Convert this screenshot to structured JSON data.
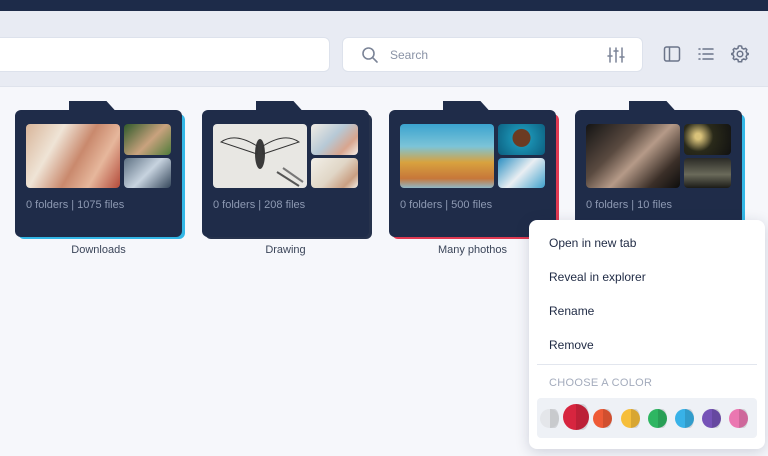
{
  "search": {
    "placeholder": "Search"
  },
  "toolbar": {
    "icons": [
      "search-icon",
      "filter-sliders-icon",
      "panel-icon",
      "list-view-icon",
      "gear-icon"
    ]
  },
  "folders": [
    {
      "name": "Downloads",
      "counts": "0 folders | 1075 files",
      "accent": "#33b7e6"
    },
    {
      "name": "Drawing",
      "counts": "0 folders | 208 files",
      "accent": ""
    },
    {
      "name": "Many phothos",
      "counts": "0 folders | 500 files",
      "accent": "#e03a52"
    },
    {
      "name": "",
      "counts": "0 folders | 10 files",
      "accent": "#33b7e6"
    }
  ],
  "context_menu": {
    "items": [
      "Open in new tab",
      "Reveal in explorer",
      "Rename",
      "Remove"
    ],
    "color_section": "CHOOSE A COLOR",
    "colors": [
      "#e4e6ea",
      "#d7253f",
      "#ee5a36",
      "#f6be3a",
      "#2eb662",
      "#38b2e8",
      "#7552b7",
      "#eb77b1"
    ],
    "selected_color": "#d7253f"
  }
}
